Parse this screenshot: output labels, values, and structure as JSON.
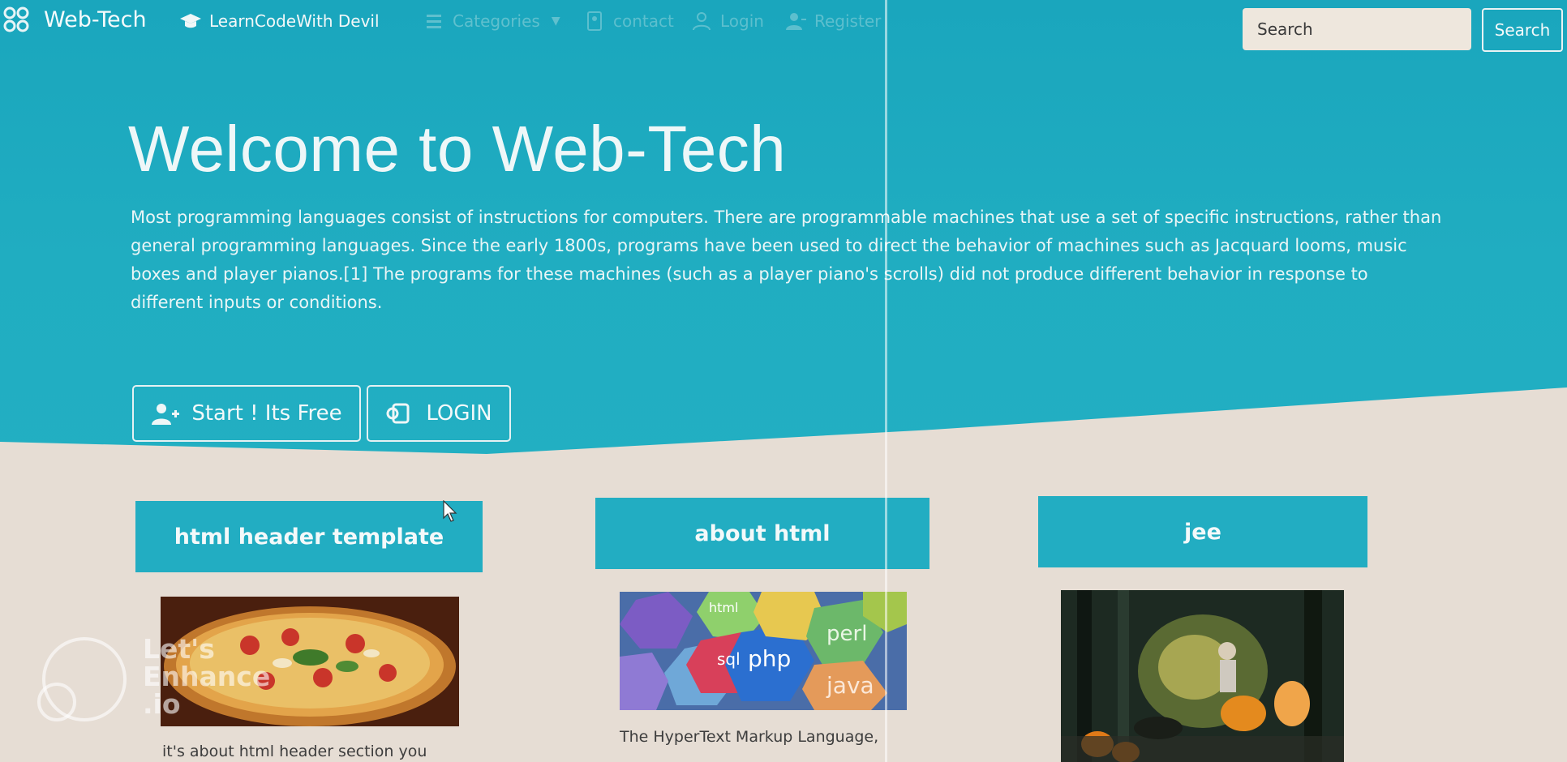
{
  "navbar": {
    "brand": "Web-Tech",
    "learn_link": "LearnCodeWith Devil",
    "categories": "Categories",
    "contact": "contact",
    "login": "Login",
    "register": "Register",
    "search_placeholder": "Search",
    "search_button": "Search"
  },
  "hero": {
    "title": "Welcome to Web-Tech",
    "text": "Most programming languages consist of instructions for computers. There are programmable machines that use a set of specific instructions, rather than general programming languages. Since the early 1800s, programs have been used to direct the behavior of machines such as Jacquard looms, music boxes and player pianos.[1] The programs for these machines (such as a player piano's scrolls) did not produce different behavior in response to different inputs or conditions.",
    "start_button": "Start ! Its Free",
    "login_button": "LOGIN"
  },
  "cards": [
    {
      "title": "html header template",
      "text": "it's about html header section you",
      "image": "pizza-photo"
    },
    {
      "title": "about html",
      "text": "The HyperText Markup Language,",
      "image": "programming-languages-hexagons"
    },
    {
      "title": "jee",
      "text": "",
      "image": "forest-scene-photo"
    }
  ],
  "watermark": {
    "line1": "Let's",
    "line2": "Enhance",
    "line3": ".io"
  },
  "colors": {
    "primary": "#22adc2",
    "page_bg": "#e6ddd4"
  }
}
